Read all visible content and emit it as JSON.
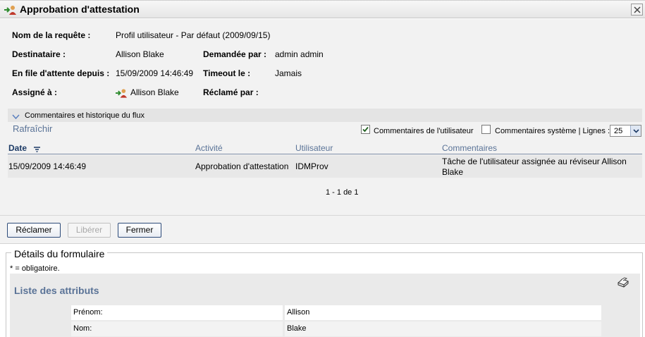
{
  "window": {
    "title": "Approbation d'attestation"
  },
  "info": {
    "request_name_label": "Nom de la requête :",
    "request_name_value": "Profil utilisateur - Par défaut (2009/09/15)",
    "recipient_label": "Destinataire :",
    "recipient_value": "Allison Blake",
    "requested_by_label": "Demandée par :",
    "requested_by_value": "admin admin",
    "queued_since_label": "En file d'attente depuis :",
    "queued_since_value": "15/09/2009 14:46:49",
    "timeout_label": "Timeout le :",
    "timeout_value": "Jamais",
    "assigned_label": "Assigné à :",
    "assigned_value": "Allison Blake",
    "claimed_by_label": "Réclamé par :"
  },
  "flow": {
    "header": "Commentaires et historique du flux",
    "refresh": "Rafraîchir",
    "user_comments_label": "Commentaires de l'utilisateur",
    "user_comments_checked": true,
    "system_comments_label": "Commentaires système | Lignes :",
    "system_comments_checked": false,
    "lines_value": "25",
    "columns": [
      "Date",
      "Activité",
      "Utilisateur",
      "Commentaires"
    ],
    "rows": [
      {
        "date": "15/09/2009 14:46:49",
        "activity": "Approbation d'attestation",
        "user": "IDMProv",
        "comment_line1": "Tâche de l'utilisateur assignée au réviseur Allison",
        "comment_line2": "Blake"
      }
    ],
    "pager": "1 - 1 de 1"
  },
  "buttons": {
    "claim": "Réclamer",
    "release": "Libérer",
    "close": "Fermer"
  },
  "form": {
    "legend": "Détails du formulaire",
    "required_note": "* = obligatoire.",
    "attributes_title": "Liste des attributs",
    "attributes": [
      {
        "label": "Prénom:",
        "value": "Allison"
      },
      {
        "label": "Nom:",
        "value": "Blake"
      }
    ]
  },
  "colors": {
    "link": "#5a7397",
    "panel_bg": "#f2f2f2",
    "button_border": "#2c4a78"
  },
  "icons": [
    "assign-user-icon",
    "close-icon",
    "chevron-down-icon",
    "sort-icon",
    "print-icon"
  ]
}
